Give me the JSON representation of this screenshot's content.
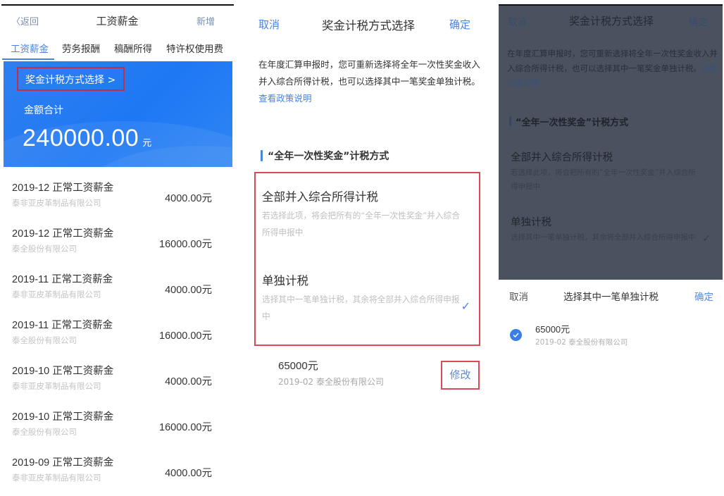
{
  "salary_screen": {
    "nav": {
      "back_label": "〈返回",
      "title": "工资薪金",
      "add_label": "新增"
    },
    "tabs": [
      {
        "label": "工资薪金",
        "active": true
      },
      {
        "label": "劳务报酬",
        "active": false
      },
      {
        "label": "稿酬所得",
        "active": false
      },
      {
        "label": "特许权使用费",
        "active": false
      }
    ],
    "card": {
      "bonus_method_link": "奖金计税方式选择 >",
      "sum_label": "金额合计",
      "sum_value": "240000.00",
      "sum_unit": "元"
    },
    "items": [
      {
        "title": "2019-12 正常工资薪金",
        "company": "泰非亚皮革制品有限公司",
        "amount": "4000.00元"
      },
      {
        "title": "2019-12 正常工资薪金",
        "company": "泰全股份有限公司",
        "amount": "16000.00元"
      },
      {
        "title": "2019-11 正常工资薪金",
        "company": "泰非亚皮革制品有限公司",
        "amount": "4000.00元"
      },
      {
        "title": "2019-11 正常工资薪金",
        "company": "泰全股份有限公司",
        "amount": "16000.00元"
      },
      {
        "title": "2019-10 正常工资薪金",
        "company": "泰非亚皮革制品有限公司",
        "amount": "4000.00元"
      },
      {
        "title": "2019-10 正常工资薪金",
        "company": "泰全股份有限公司",
        "amount": "16000.00元"
      },
      {
        "title": "2019-09 正常工资薪金",
        "company": "泰非亚皮革制品有限公司",
        "amount": "4000.00元"
      }
    ]
  },
  "method_screen": {
    "nav": {
      "cancel_label": "取消",
      "title": "奖金计税方式选择",
      "confirm_label": "确定"
    },
    "description": "在年度汇算申报时，您可重新选择将全年一次性奖金收入并入综合所得计税，也可以选择其中一笔奖金单独计税。",
    "policy_link": "查看政策说明",
    "section_title": "“全年一次性奖金”计税方式",
    "options": [
      {
        "title": "全部并入综合所得计税",
        "description": "若选择此项，将会把所有的“全年一次性奖金”并入综合所得申报中",
        "selected": false
      },
      {
        "title": "单独计税",
        "description": "选择其中一笔单独计税，其余将全部并入综合所得申报中",
        "selected": true
      }
    ],
    "selected_bonus": {
      "amount": "65000元",
      "meta": "2019-02 泰全股份有限公司"
    },
    "modify_label": "修改",
    "check_icon": "✓"
  },
  "picker_screen": {
    "background": {
      "nav": {
        "cancel_label": "取消",
        "title": "奖金计税方式选择",
        "confirm_label": "确定"
      },
      "description": "在年度汇算申报时，您可重新选择将全年一次性奖金收入并入综合所得计税，也可以选择其中一笔奖金单独计税。",
      "policy_link": "查看政策说明",
      "section_title": "“全年一次性奖金”计税方式",
      "options": [
        {
          "title": "全部并入综合所得计税",
          "description": "若选择此项，将会把所有的“全年一次性奖金”并入综合所得申报中"
        },
        {
          "title": "单独计税",
          "description": "选择其中一笔单独计税，其余将全部并入综合所得申报中"
        }
      ],
      "check_icon": "✓"
    },
    "sheet": {
      "cancel_label": "取消",
      "title": "选择其中一笔单独计税",
      "confirm_label": "确定",
      "items": [
        {
          "amount": "65000元",
          "meta": "2019-02 泰全股份有限公司",
          "checked": true
        }
      ]
    }
  },
  "colors": {
    "accent_blue": "#4b84e0",
    "card_blue": "#1e78f4",
    "highlight_red": "#d84a58",
    "overlay": "#4a5260"
  }
}
